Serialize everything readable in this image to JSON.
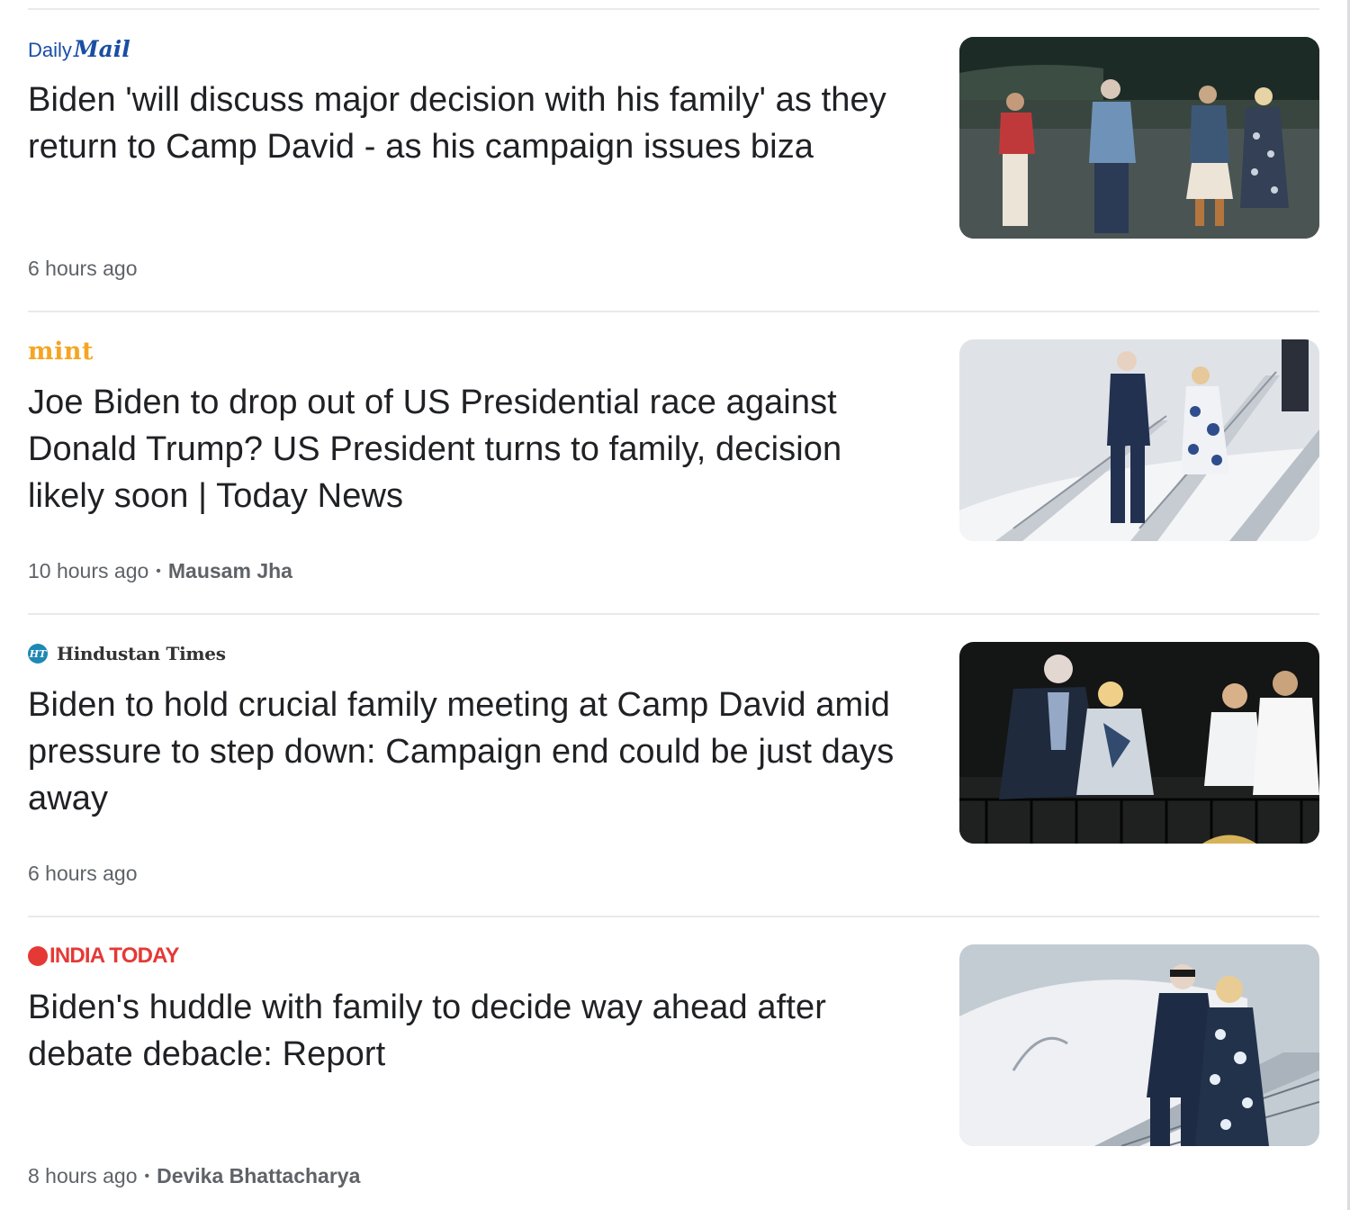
{
  "articles": [
    {
      "source": {
        "name": "Daily Mail",
        "logo_parts": [
          "Daily",
          "Mail"
        ],
        "logo_color": "#1a4ea5"
      },
      "headline": "Biden 'will discuss major decision with his family' as they return to Camp David - as his campaign issues biza",
      "time": "6 hours ago",
      "author": null,
      "thumbnail": {
        "scene": "night-tarmac-family-walking"
      }
    },
    {
      "source": {
        "name": "mint",
        "logo_color": "#f4a623"
      },
      "headline": "Joe Biden to drop out of US Presidential race against Donald Trump? US President turns to family, decision likely soon | Today News",
      "time": "10 hours ago",
      "author": "Mausam Jha",
      "thumbnail": {
        "scene": "descending-airplane-stairs"
      }
    },
    {
      "source": {
        "name": "Hindustan Times",
        "badge": "HT",
        "logo_color": "#1e88b4"
      },
      "headline": "Biden to hold crucial family meeting at Camp David amid pressure to step down: Campaign end could be just days away",
      "time": "6 hours ago",
      "author": null,
      "thumbnail": {
        "scene": "balcony-family-night"
      }
    },
    {
      "source": {
        "name": "INDIA TODAY",
        "logo_color": "#e53935"
      },
      "headline": "Biden's huddle with family to decide way ahead after debate debacle: Report",
      "time": "8 hours ago",
      "author": "Devika Bhattacharya",
      "thumbnail": {
        "scene": "couple-descending-plane"
      }
    }
  ],
  "meta_separator": "•"
}
